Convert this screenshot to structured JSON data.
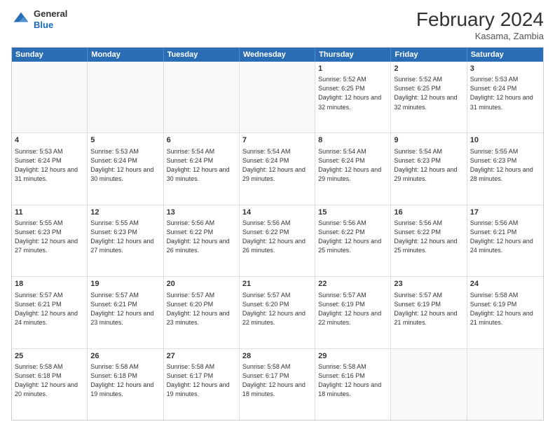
{
  "header": {
    "logo": {
      "general": "General",
      "blue": "Blue"
    },
    "month_title": "February 2024",
    "location": "Kasama, Zambia"
  },
  "days_of_week": [
    "Sunday",
    "Monday",
    "Tuesday",
    "Wednesday",
    "Thursday",
    "Friday",
    "Saturday"
  ],
  "weeks": [
    [
      {
        "day": "",
        "empty": true
      },
      {
        "day": "",
        "empty": true
      },
      {
        "day": "",
        "empty": true
      },
      {
        "day": "",
        "empty": true
      },
      {
        "day": "1",
        "sunrise": "5:52 AM",
        "sunset": "6:25 PM",
        "daylight": "12 hours and 32 minutes."
      },
      {
        "day": "2",
        "sunrise": "5:52 AM",
        "sunset": "6:25 PM",
        "daylight": "12 hours and 32 minutes."
      },
      {
        "day": "3",
        "sunrise": "5:53 AM",
        "sunset": "6:24 PM",
        "daylight": "12 hours and 31 minutes."
      }
    ],
    [
      {
        "day": "4",
        "sunrise": "5:53 AM",
        "sunset": "6:24 PM",
        "daylight": "12 hours and 31 minutes."
      },
      {
        "day": "5",
        "sunrise": "5:53 AM",
        "sunset": "6:24 PM",
        "daylight": "12 hours and 30 minutes."
      },
      {
        "day": "6",
        "sunrise": "5:54 AM",
        "sunset": "6:24 PM",
        "daylight": "12 hours and 30 minutes."
      },
      {
        "day": "7",
        "sunrise": "5:54 AM",
        "sunset": "6:24 PM",
        "daylight": "12 hours and 29 minutes."
      },
      {
        "day": "8",
        "sunrise": "5:54 AM",
        "sunset": "6:24 PM",
        "daylight": "12 hours and 29 minutes."
      },
      {
        "day": "9",
        "sunrise": "5:54 AM",
        "sunset": "6:23 PM",
        "daylight": "12 hours and 29 minutes."
      },
      {
        "day": "10",
        "sunrise": "5:55 AM",
        "sunset": "6:23 PM",
        "daylight": "12 hours and 28 minutes."
      }
    ],
    [
      {
        "day": "11",
        "sunrise": "5:55 AM",
        "sunset": "6:23 PM",
        "daylight": "12 hours and 27 minutes."
      },
      {
        "day": "12",
        "sunrise": "5:55 AM",
        "sunset": "6:23 PM",
        "daylight": "12 hours and 27 minutes."
      },
      {
        "day": "13",
        "sunrise": "5:56 AM",
        "sunset": "6:22 PM",
        "daylight": "12 hours and 26 minutes."
      },
      {
        "day": "14",
        "sunrise": "5:56 AM",
        "sunset": "6:22 PM",
        "daylight": "12 hours and 26 minutes."
      },
      {
        "day": "15",
        "sunrise": "5:56 AM",
        "sunset": "6:22 PM",
        "daylight": "12 hours and 25 minutes."
      },
      {
        "day": "16",
        "sunrise": "5:56 AM",
        "sunset": "6:22 PM",
        "daylight": "12 hours and 25 minutes."
      },
      {
        "day": "17",
        "sunrise": "5:56 AM",
        "sunset": "6:21 PM",
        "daylight": "12 hours and 24 minutes."
      }
    ],
    [
      {
        "day": "18",
        "sunrise": "5:57 AM",
        "sunset": "6:21 PM",
        "daylight": "12 hours and 24 minutes."
      },
      {
        "day": "19",
        "sunrise": "5:57 AM",
        "sunset": "6:21 PM",
        "daylight": "12 hours and 23 minutes."
      },
      {
        "day": "20",
        "sunrise": "5:57 AM",
        "sunset": "6:20 PM",
        "daylight": "12 hours and 23 minutes."
      },
      {
        "day": "21",
        "sunrise": "5:57 AM",
        "sunset": "6:20 PM",
        "daylight": "12 hours and 22 minutes."
      },
      {
        "day": "22",
        "sunrise": "5:57 AM",
        "sunset": "6:19 PM",
        "daylight": "12 hours and 22 minutes."
      },
      {
        "day": "23",
        "sunrise": "5:57 AM",
        "sunset": "6:19 PM",
        "daylight": "12 hours and 21 minutes."
      },
      {
        "day": "24",
        "sunrise": "5:58 AM",
        "sunset": "6:19 PM",
        "daylight": "12 hours and 21 minutes."
      }
    ],
    [
      {
        "day": "25",
        "sunrise": "5:58 AM",
        "sunset": "6:18 PM",
        "daylight": "12 hours and 20 minutes."
      },
      {
        "day": "26",
        "sunrise": "5:58 AM",
        "sunset": "6:18 PM",
        "daylight": "12 hours and 19 minutes."
      },
      {
        "day": "27",
        "sunrise": "5:58 AM",
        "sunset": "6:17 PM",
        "daylight": "12 hours and 19 minutes."
      },
      {
        "day": "28",
        "sunrise": "5:58 AM",
        "sunset": "6:17 PM",
        "daylight": "12 hours and 18 minutes."
      },
      {
        "day": "29",
        "sunrise": "5:58 AM",
        "sunset": "6:16 PM",
        "daylight": "12 hours and 18 minutes."
      },
      {
        "day": "",
        "empty": true
      },
      {
        "day": "",
        "empty": true
      }
    ]
  ]
}
